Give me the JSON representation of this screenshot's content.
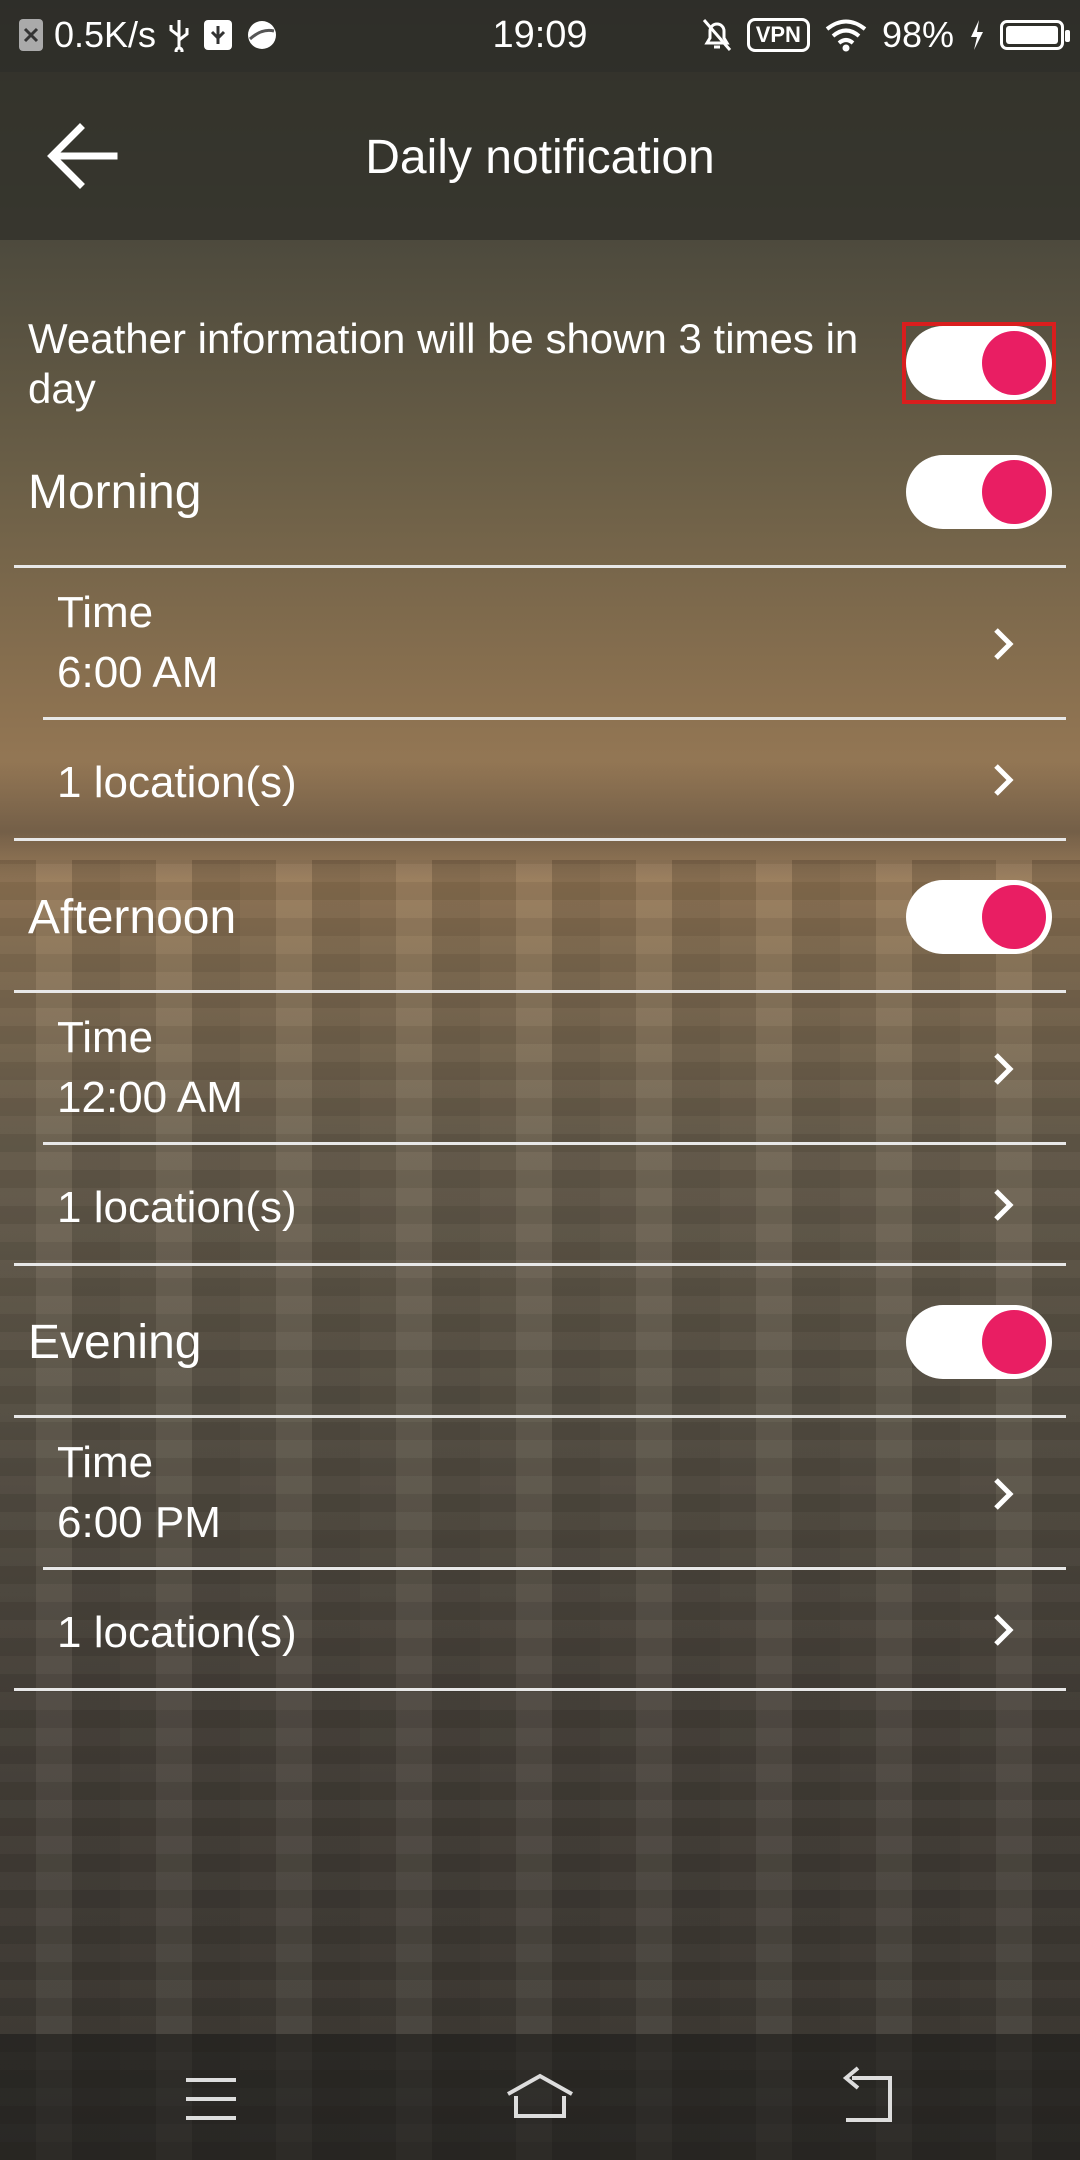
{
  "status_bar": {
    "speed": "0.5K/s",
    "time": "19:09",
    "vpn_label": "VPN",
    "battery": "98%",
    "icons": [
      "notification-x-icon",
      "usb-icon",
      "usb-debug-icon",
      "browser-icon",
      "mute-bell-icon",
      "vpn-icon",
      "wifi-icon",
      "charging-bolt-icon",
      "battery-icon"
    ]
  },
  "header": {
    "title": "Daily notification",
    "back_icon": "arrow-left-icon"
  },
  "intro": {
    "text": "Weather information will be shown 3 times in day",
    "toggle_on": true
  },
  "sections": [
    {
      "title": "Morning",
      "enabled": true,
      "time_label": "Time",
      "time_value": "6:00 AM",
      "locations": "1 location(s)"
    },
    {
      "title": "Afternoon",
      "enabled": true,
      "time_label": "Time",
      "time_value": "12:00 AM",
      "locations": "1 location(s)"
    },
    {
      "title": "Evening",
      "enabled": true,
      "time_label": "Time",
      "time_value": "6:00 PM",
      "locations": "1 location(s)"
    }
  ],
  "nav_bar": {
    "icons": [
      "menu-icon",
      "home-icon",
      "back-icon"
    ]
  },
  "colors": {
    "accent": "#e91e63",
    "highlight_border": "#d91e1e"
  }
}
